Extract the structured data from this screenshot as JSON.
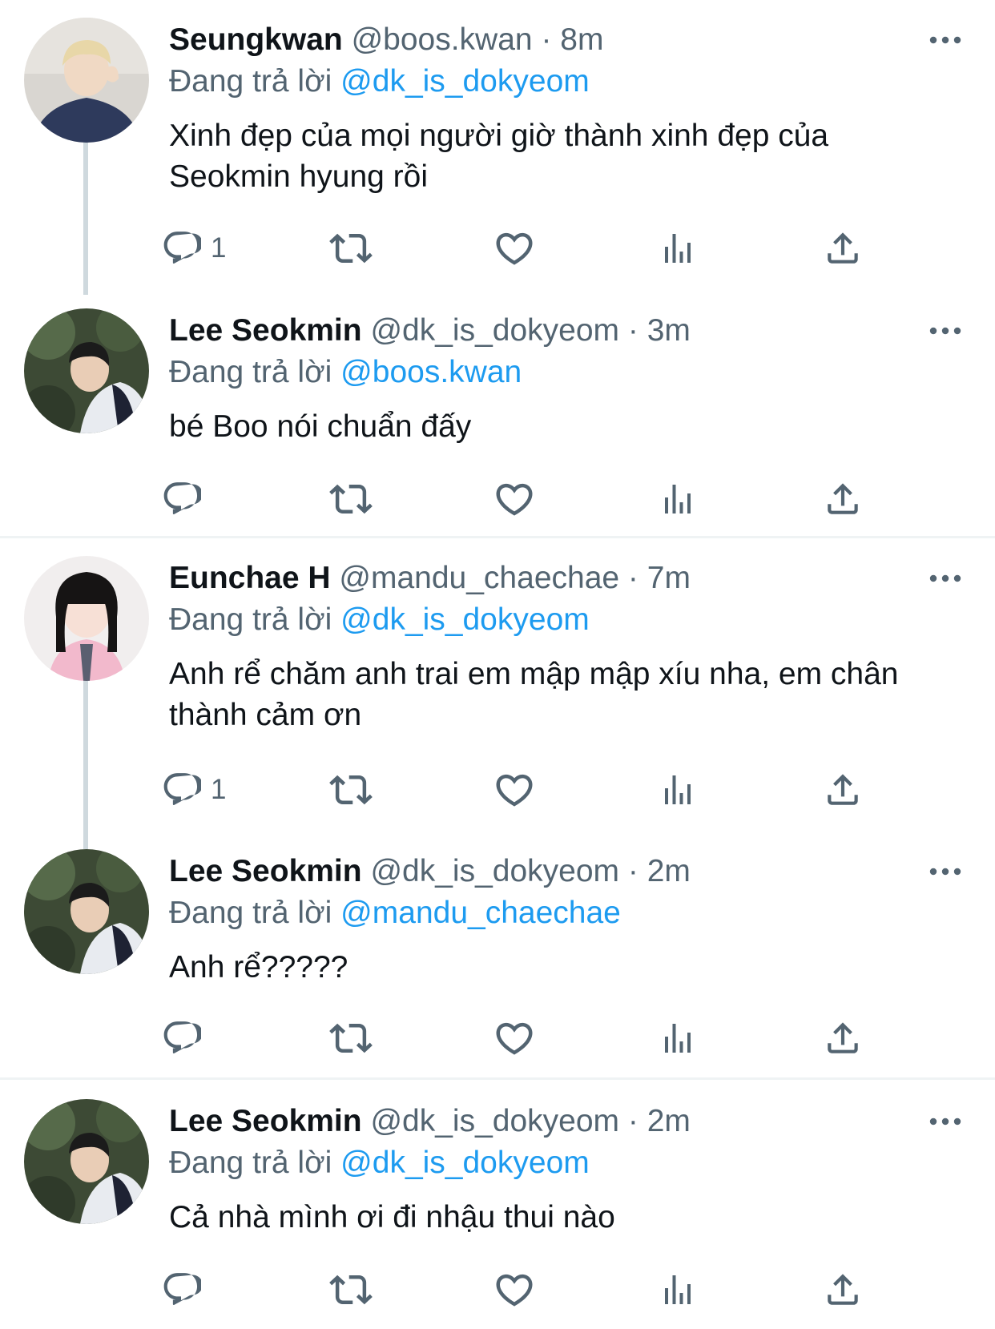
{
  "tweets": [
    {
      "name": "Seungkwan",
      "handle": "@boos.kwan",
      "dot": "·",
      "time": "8m",
      "reply_prefix": "Đang trả lời",
      "reply_to": "@dk_is_dokyeom",
      "text": "Xinh đẹp của mọi người giờ thành xinh đẹp của Seokmin hyung rồi",
      "reply_count": "1"
    },
    {
      "name": "Lee Seokmin",
      "handle": "@dk_is_dokyeom",
      "dot": "·",
      "time": "3m",
      "reply_prefix": "Đang trả lời",
      "reply_to": "@boos.kwan",
      "text": "bé Boo nói chuẩn đấy",
      "reply_count": ""
    },
    {
      "name": "Eunchae H",
      "handle": "@mandu_chaechae",
      "dot": "·",
      "time": "7m",
      "reply_prefix": "Đang trả lời",
      "reply_to": "@dk_is_dokyeom",
      "text": "Anh rể chăm anh trai em mập mập xíu nha, em chân thành cảm ơn",
      "reply_count": "1"
    },
    {
      "name": "Lee Seokmin",
      "handle": "@dk_is_dokyeom",
      "dot": "·",
      "time": "2m",
      "reply_prefix": "Đang trả lời",
      "reply_to": "@mandu_chaechae",
      "text": "Anh rể?????",
      "reply_count": ""
    },
    {
      "name": "Lee Seokmin",
      "handle": "@dk_is_dokyeom",
      "dot": "·",
      "time": "2m",
      "reply_prefix": "Đang trả lời",
      "reply_to": "@dk_is_dokyeom",
      "text": "Cả nhà mình ơi đi nhậu thui nào",
      "reply_count": ""
    }
  ],
  "icons": {
    "reply": "reply-icon",
    "retweet": "retweet-icon",
    "like": "heart-icon",
    "views": "analytics-icon",
    "share": "share-icon",
    "more": "more-icon"
  },
  "colors": {
    "text": "#0f1419",
    "secondary": "#536471",
    "mention": "#1d9bf0",
    "thread_line": "#cfd9de",
    "divider": "#eff3f4"
  }
}
